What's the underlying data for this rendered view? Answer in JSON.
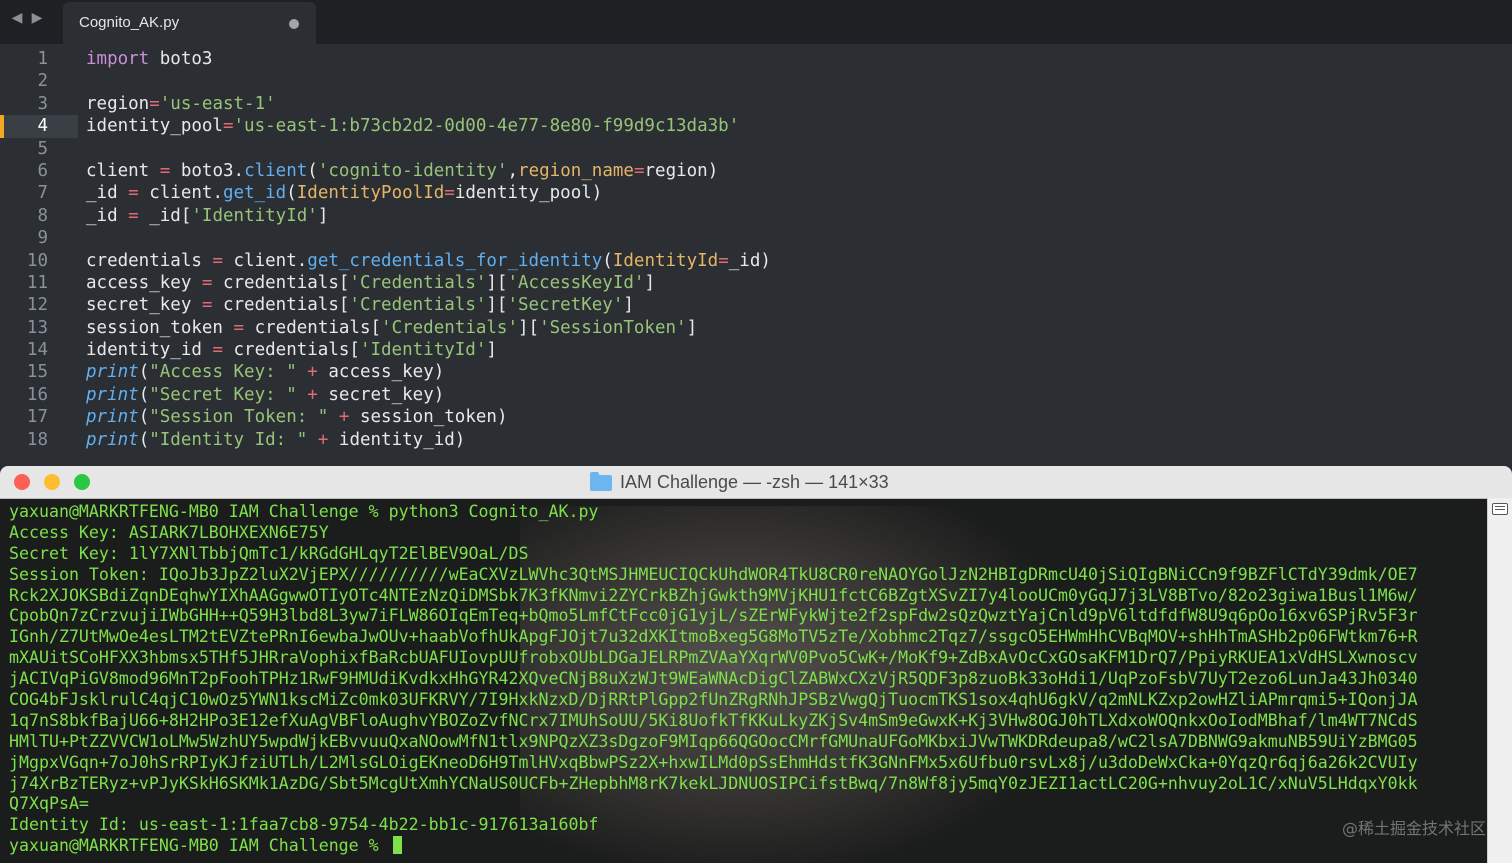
{
  "editor": {
    "tab_title": "Cognito_AK.py",
    "code_lines": [
      {
        "num": "1",
        "html": "<span class='kw'>import</span> boto3"
      },
      {
        "num": "2",
        "html": ""
      },
      {
        "num": "3",
        "html": "region<span class='op'>=</span><span class='str'>'us-east-1'</span>"
      },
      {
        "num": "4",
        "html": "identity_pool<span class='op'>=</span><span class='str'>'us-east-1:b73cb2d2-0d00-4e77-8e80-f99d9c13da3b'</span>",
        "active": true
      },
      {
        "num": "5",
        "html": ""
      },
      {
        "num": "6",
        "html": "client <span class='op'>=</span> boto3.<span class='fn'>client</span>(<span class='str'>'cognito-identity'</span>,<span class='arg'>region_name</span><span class='op'>=</span>region)"
      },
      {
        "num": "7",
        "html": "_id <span class='op'>=</span> client.<span class='fn'>get_id</span>(<span class='arg'>IdentityPoolId</span><span class='op'>=</span>identity_pool)"
      },
      {
        "num": "8",
        "html": "_id <span class='op'>=</span> _id[<span class='str'>'IdentityId'</span>]"
      },
      {
        "num": "9",
        "html": ""
      },
      {
        "num": "10",
        "html": "credentials <span class='op'>=</span> client.<span class='fn'>get_credentials_for_identity</span>(<span class='arg'>IdentityId</span><span class='op'>=</span>_id)"
      },
      {
        "num": "11",
        "html": "access_key <span class='op'>=</span> credentials[<span class='str'>'Credentials'</span>][<span class='str'>'AccessKeyId'</span>]"
      },
      {
        "num": "12",
        "html": "secret_key <span class='op'>=</span> credentials[<span class='str'>'Credentials'</span>][<span class='str'>'SecretKey'</span>]"
      },
      {
        "num": "13",
        "html": "session_token <span class='op'>=</span> credentials[<span class='str'>'Credentials'</span>][<span class='str'>'SessionToken'</span>]"
      },
      {
        "num": "14",
        "html": "identity_id <span class='op'>=</span> credentials[<span class='str'>'IdentityId'</span>]"
      },
      {
        "num": "15",
        "html": "<span class='it'>print</span>(<span class='str'>\"Access Key: \"</span> <span class='op'>+</span> access_key)"
      },
      {
        "num": "16",
        "html": "<span class='it'>print</span>(<span class='str'>\"Secret Key: \"</span> <span class='op'>+</span> secret_key)"
      },
      {
        "num": "17",
        "html": "<span class='it'>print</span>(<span class='str'>\"Session Token: \"</span> <span class='op'>+</span> session_token)"
      },
      {
        "num": "18",
        "html": "<span class='it'>print</span>(<span class='str'>\"Identity Id: \"</span> <span class='op'>+</span> identity_id)"
      }
    ]
  },
  "terminal": {
    "title": "IAM Challenge — -zsh — 141×33",
    "lines": [
      "yaxuan@MARKRTFENG-MB0 IAM Challenge % python3 Cognito_AK.py",
      "Access Key: ASIARK7LBOHXEXN6E75Y",
      "Secret Key: 1lY7XNlTbbjQmTc1/kRGdGHLqyT2ElBEV9OaL/DS",
      "Session Token: IQoJb3JpZ2luX2VjEPX//////////wEaCXVzLWVhc3QtMSJHMEUCIQCkUhdWOR4TkU8CR0reNAOYGolJzN2HBIgDRmcU40jSiQIgBNiCCn9f9BZFlCTdY39dmk/OE7",
      "Rck2XJOKSBdiZqnDEqhwYIXhAAGgwwOTIyOTc4NTEzNzQiDMSbk7K3fKNmvi2ZYCrkBZhjGwkth9MVjKHU1fctC6BZgtXSvZI7y4looUCm0yGqJ7j3LV8BTvo/82o23giwa1Busl1M6w/",
      "CpobQn7zCrzvujiIWbGHH++Q59H3lbd8L3yw7iFLW86OIqEmTeq+bQmo5LmfCtFcc0jG1yjL/sZErWFykWjte2f2spFdw2sQzQwztYajCnld9pV6ltdfdfW8U9q6pOo16xv6SPjRv5F3r",
      "IGnh/Z7UtMwOe4esLTM2tEVZtePRnI6ewbaJwOUv+haabVofhUkApgFJOjt7u32dXKItmoBxeg5G8MoTV5zTe/Xobhmc2Tqz7/ssgcO5EHWmHhCVBqMOV+shHhTmASHb2p06FWtkm76+R",
      "mXAUitSCoHFXX3hbmsx5THf5JHRraVophixfBaRcbUAFUIovpUUfrobxOUbLDGaJELRPmZVAaYXqrWV0Pvo5CwK+/MoKf9+ZdBxAvOcCxGOsaKFM1DrQ7/PpiyRKUEA1xVdHSLXwnoscv",
      "jACIVqPiGV8mod96MnT2pFoohTPHz1RwF9HMUdiKvdkxHhGYR42XQveCNjB8uXzWJt9WEaWNAcDigClZABWxCXzVjR5QDF3p8zuoBk33oHdi1/UqPzoFsbV7UyT2ezo6LunJa43Jh0340",
      "COG4bFJsklrulC4qjC10wOz5YWN1kscMiZc0mk03UFKRVY/7I9HxkNzxD/DjRRtPlGpp2fUnZRgRNhJPSBzVwgQjTuocmTKS1sox4qhU6gkV/q2mNLKZxp2owHZliAPmrqmi5+IQonjJA",
      "1q7nS8bkfBajU66+8H2HPo3E12efXuAgVBFloAughvYBOZoZvfNCrx7IMUhSoUU/5Ki8UofkTfKKuLkyZKjSv4mSm9eGwxK+Kj3VHw8OGJ0hTLXdxoWOQnkxOoIodMBhaf/lm4WT7NCdS",
      "HMlTU+PtZZVVCW1oLMw5WzhUY5wpdWjkEBvvuuQxaNOowMfN1tlx9NPQzXZ3sDgzoF9MIqp66QGOocCMrfGMUnaUFGoMKbxiJVwTWKDRdeupa8/wC2lsA7DBNWG9akmuNB59UiYzBMG05",
      "jMgpxVGqn+7oJ0hSrRPIyKJfziUTLh/L2MlsGLOigEKneoD6H9TmlHVxqBbwPSz2X+hxwILMd0pSsEhmHdstfK3GNnFMx5x6Ufbu0rsvLx8j/u3doDeWxCka+0YqzQr6qj6a26k2CVUIy",
      "j74XrBzTERyz+vPJyKSkH6SKMk1AzDG/Sbt5McgUtXmhYCNaUS0UCFb+ZHepbhM8rK7kekLJDNUOSIPCifstBwq/7n8Wf8jy5mqY0zJEZI1actLC20G+nhvuy2oL1C/xNuV5LHdqxY0kk",
      "Q7XqPsA=",
      "Identity Id: us-east-1:1faa7cb8-9754-4b22-bb1c-917613a160bf"
    ],
    "prompt": "yaxuan@MARKRTFENG-MB0 IAM Challenge % ",
    "watermark": "@稀土掘金技术社区"
  }
}
